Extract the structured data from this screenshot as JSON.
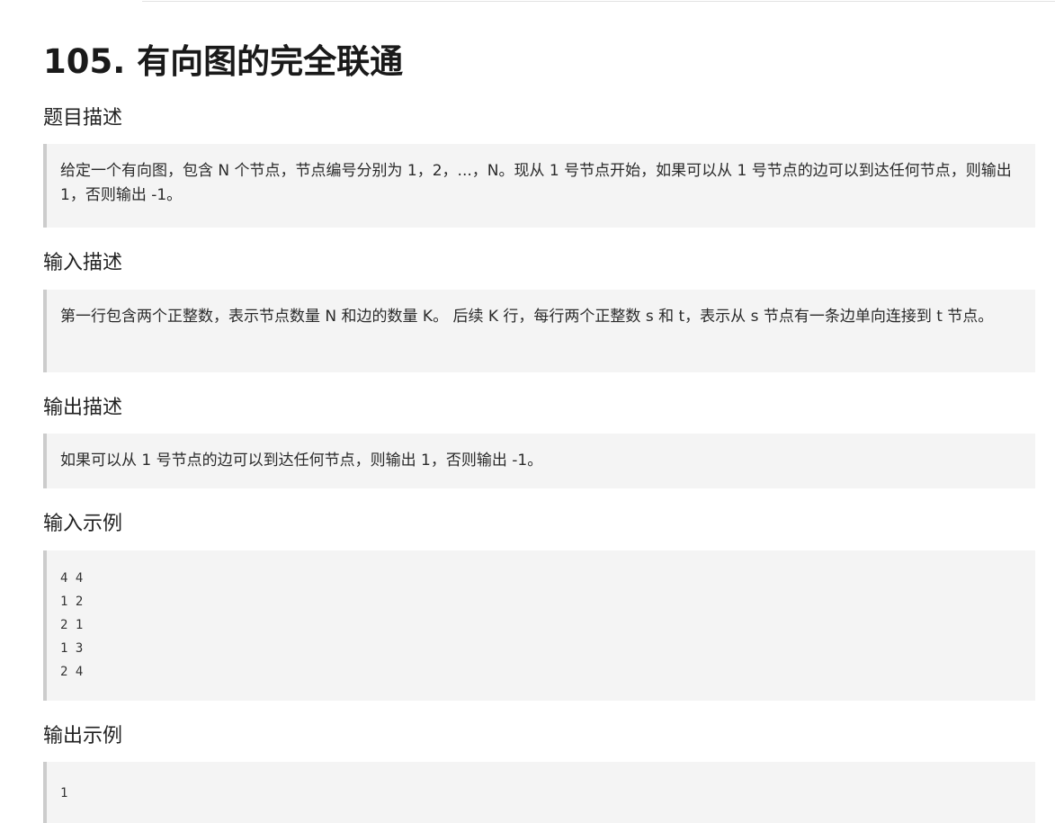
{
  "problem": {
    "title": "105. 有向图的完全联通",
    "sections": [
      {
        "heading": "题目描述",
        "text": "给定一个有向图，包含 N 个节点，节点编号分别为 1，2，...，N。现从 1 号节点开始，如果可以从 1 号节点的边可以到达任何节点，则输出 1，否则输出 -1。"
      },
      {
        "heading": "输入描述",
        "text": "第一行包含两个正整数，表示节点数量 N 和边的数量 K。 后续 K 行，每行两个正整数 s 和 t，表示从 s 节点有一条边单向连接到 t 节点。"
      },
      {
        "heading": "输出描述",
        "text": "如果可以从 1 号节点的边可以到达任何节点，则输出 1，否则输出 -1。"
      }
    ],
    "input_example": {
      "heading": "输入示例",
      "lines": [
        "4 4",
        "1 2",
        "2 1",
        "1 3",
        "2 4"
      ]
    },
    "output_example": {
      "heading": "输出示例",
      "lines": [
        "1"
      ]
    }
  }
}
